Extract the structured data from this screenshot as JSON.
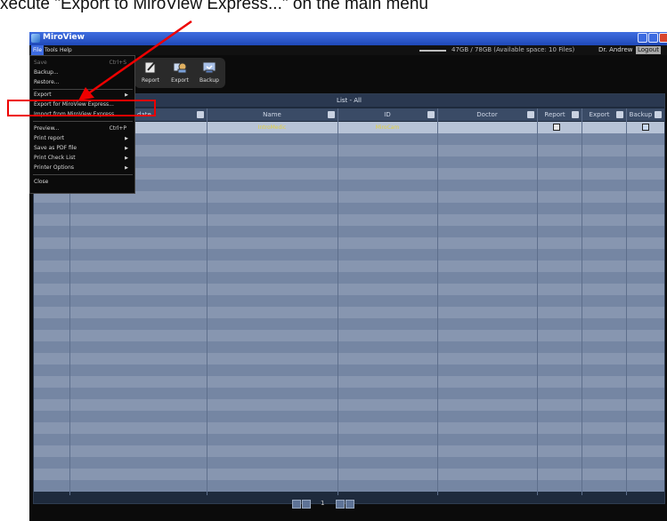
{
  "caption": "xecute \"Export to MiroView Express...\" on the main menu",
  "window": {
    "title": "MiroView"
  },
  "menubar": {
    "file": "File",
    "tools": "Tools",
    "help": "Help",
    "storage": "47GB / 78GB (Available space: 10 Files)",
    "user": "Dr. Andrew",
    "logout": "Logout"
  },
  "toolbar": {
    "report": "Report",
    "export": "Export",
    "backup": "Backup"
  },
  "list": {
    "title": "List - All",
    "headers": [
      "date",
      "Name",
      "ID",
      "Doctor",
      "Report",
      "Export",
      "Backup"
    ],
    "row1": {
      "date": "2007",
      "name": "IntroMedic",
      "id": "MiroCam"
    }
  },
  "file_menu": {
    "save": "Save",
    "save_shortcut": "Ctrl+S",
    "backup": "Backup...",
    "restore": "Restore...",
    "export": "Export",
    "export_miroview": "Export for MiroView Express...",
    "import_miroview": "Import from MiroView Express...",
    "preview": "Preview...",
    "preview_shortcut": "Ctrl+P",
    "print_report": "Print report",
    "save_pdf": "Save as PDF file",
    "print_checklist": "Print Check List",
    "printer_options": "Printer Options",
    "close": "Close"
  },
  "pager": {
    "page": "1"
  }
}
